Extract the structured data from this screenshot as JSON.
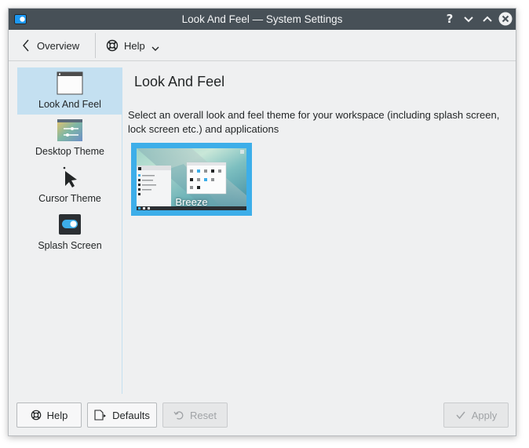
{
  "window": {
    "title": "Look And Feel — System Settings"
  },
  "toolbar": {
    "overview_label": "Overview",
    "help_label": "Help"
  },
  "sidebar": {
    "items": [
      {
        "label": "Look And Feel",
        "icon": "window-icon",
        "selected": true
      },
      {
        "label": "Desktop Theme",
        "icon": "desktop-theme-icon",
        "selected": false
      },
      {
        "label": "Cursor Theme",
        "icon": "cursor-icon",
        "selected": false
      },
      {
        "label": "Splash Screen",
        "icon": "splash-toggle-icon",
        "selected": false
      }
    ]
  },
  "main": {
    "title": "Look And Feel",
    "description": "Select an overall look and feel theme for your workspace (including splash screen, lock screen etc.) and applications",
    "themes": [
      {
        "name": "Breeze",
        "selected": true
      }
    ]
  },
  "footer": {
    "help_label": "Help",
    "defaults_label": "Defaults",
    "reset_label": "Reset",
    "apply_label": "Apply"
  },
  "colors": {
    "titlebar": "#475057",
    "accent": "#3daee9",
    "selection": "#c4e0f1",
    "background": "#eff0f1"
  }
}
